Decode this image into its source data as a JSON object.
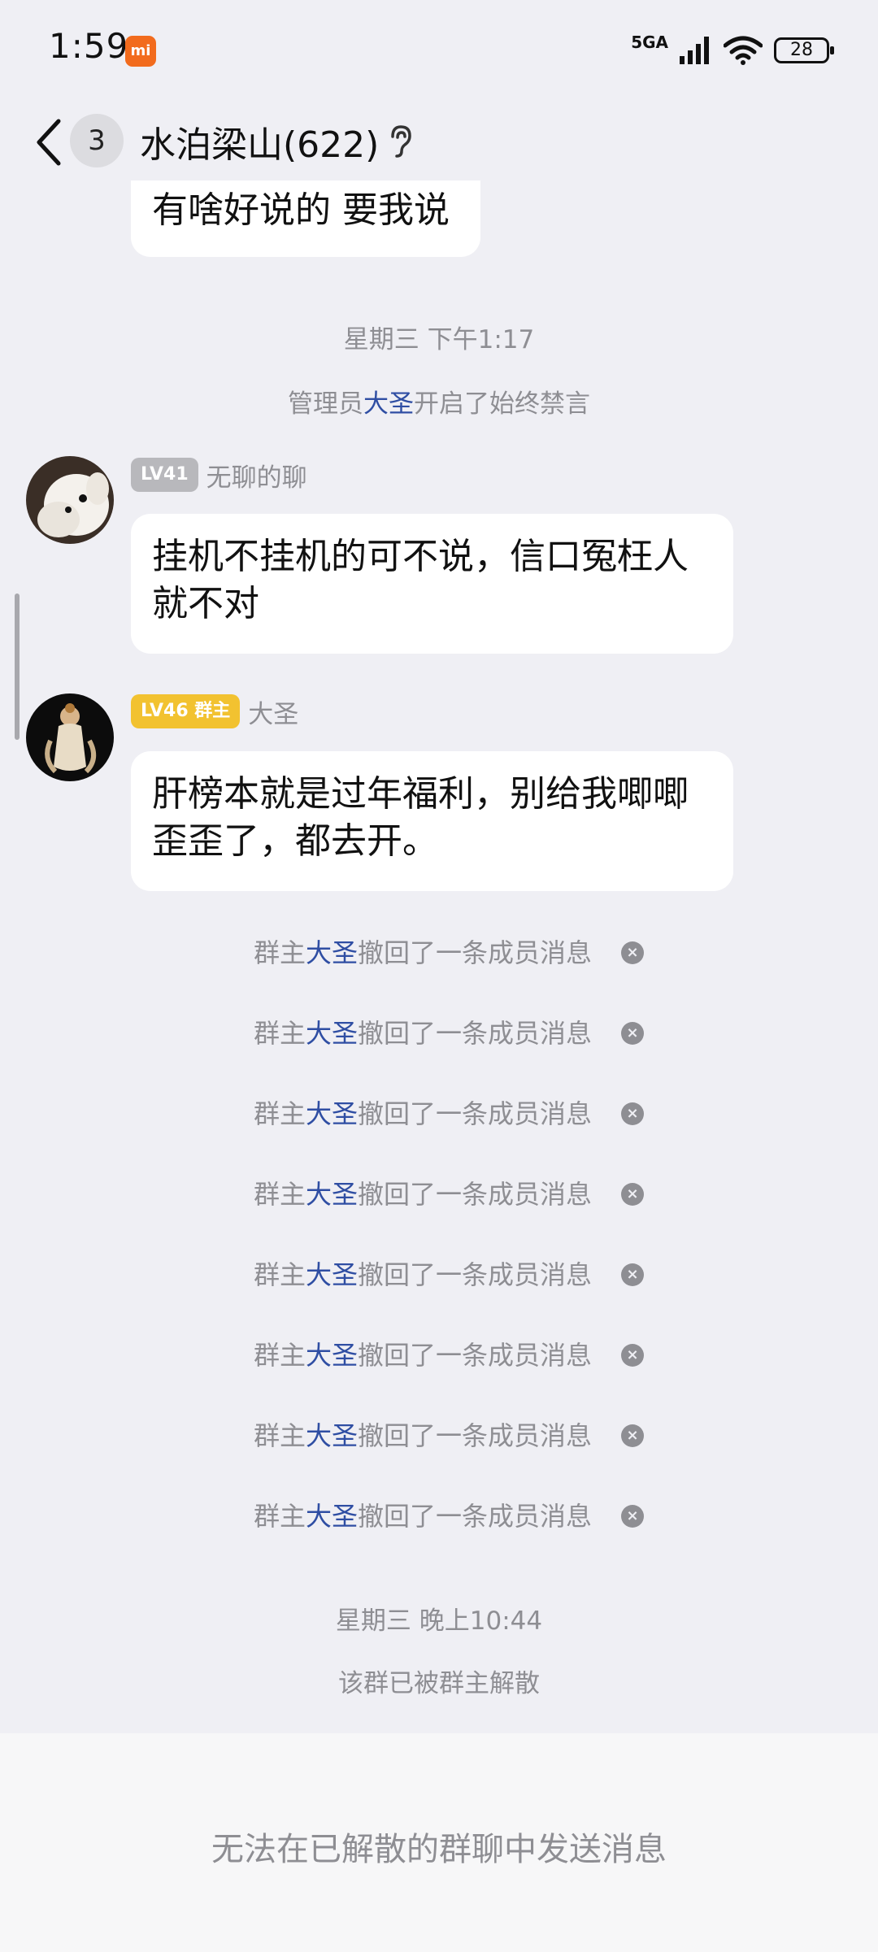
{
  "status_bar": {
    "time": "1:59",
    "mi_label": "mi",
    "network": "5GA",
    "battery": "28"
  },
  "header": {
    "unread_count": "3",
    "title": "水泊梁山(622)"
  },
  "messages": {
    "partial_bubble": "有啥好说的 要我说",
    "timestamp_1": "星期三 下午1:17",
    "sys_admin": {
      "prefix": "管理员",
      "name": "大圣",
      "suffix": "开启了始终禁言"
    },
    "msg1": {
      "level": "LV41",
      "sender": "无聊的聊",
      "text": "挂机不挂机的可不说，信口冤枉人就不对"
    },
    "msg2": {
      "level": "LV46 群主",
      "sender": "大圣",
      "text": "肝榜本就是过年福利，别给我唧唧歪歪了，都去开。"
    },
    "recalls": [
      {
        "prefix": "群主",
        "name": "大圣",
        "suffix": "撤回了一条成员消息"
      },
      {
        "prefix": "群主",
        "name": "大圣",
        "suffix": "撤回了一条成员消息"
      },
      {
        "prefix": "群主",
        "name": "大圣",
        "suffix": "撤回了一条成员消息"
      },
      {
        "prefix": "群主",
        "name": "大圣",
        "suffix": "撤回了一条成员消息"
      },
      {
        "prefix": "群主",
        "name": "大圣",
        "suffix": "撤回了一条成员消息"
      },
      {
        "prefix": "群主",
        "name": "大圣",
        "suffix": "撤回了一条成员消息"
      },
      {
        "prefix": "群主",
        "name": "大圣",
        "suffix": "撤回了一条成员消息"
      },
      {
        "prefix": "群主",
        "name": "大圣",
        "suffix": "撤回了一条成员消息"
      }
    ],
    "recall_close_glyph": "×",
    "timestamp_2": "星期三 晚上10:44",
    "dissolved_notice": "该群已被群主解散"
  },
  "footer": {
    "notice": "无法在已解散的群聊中发送消息"
  },
  "colors": {
    "background": "#efeff4",
    "highlight_name": "#2f4ea3",
    "gold_badge": "#f2c230",
    "gray_badge": "#b8b8bc"
  }
}
